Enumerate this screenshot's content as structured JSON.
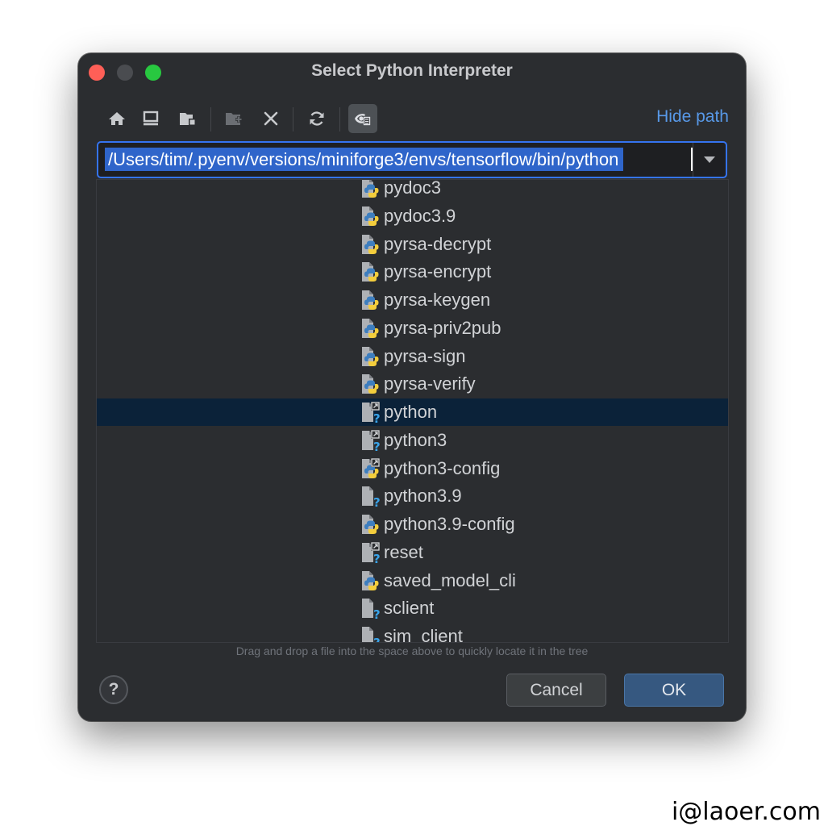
{
  "window": {
    "title": "Select Python Interpreter"
  },
  "toolbar": {
    "buttons": [
      {
        "icon": "home-icon"
      },
      {
        "icon": "desktop-icon"
      },
      {
        "icon": "project-folder-icon"
      },
      {
        "icon": "new-folder-icon"
      },
      {
        "icon": "delete-icon"
      },
      {
        "icon": "refresh-icon"
      },
      {
        "icon": "show-hidden-files-icon"
      }
    ],
    "hide_path_label": "Hide path"
  },
  "path_field": {
    "value": "/Users/tim/.pyenv/versions/miniforge3/envs/tensorflow/bin/python"
  },
  "tree": {
    "items": [
      {
        "label": "pydoc3",
        "icon": "python-file-icon"
      },
      {
        "label": "pydoc3.9",
        "icon": "python-file-icon"
      },
      {
        "label": "pyrsa-decrypt",
        "icon": "python-file-icon"
      },
      {
        "label": "pyrsa-encrypt",
        "icon": "python-file-icon"
      },
      {
        "label": "pyrsa-keygen",
        "icon": "python-file-icon"
      },
      {
        "label": "pyrsa-priv2pub",
        "icon": "python-file-icon"
      },
      {
        "label": "pyrsa-sign",
        "icon": "python-file-icon"
      },
      {
        "label": "pyrsa-verify",
        "icon": "python-file-icon"
      },
      {
        "label": "python",
        "icon": "unknown-link-file-icon",
        "selected": true
      },
      {
        "label": "python3",
        "icon": "unknown-link-file-icon"
      },
      {
        "label": "python3-config",
        "icon": "python-link-file-icon"
      },
      {
        "label": "python3.9",
        "icon": "unknown-file-icon"
      },
      {
        "label": "python3.9-config",
        "icon": "python-file-icon"
      },
      {
        "label": "reset",
        "icon": "unknown-link-file-icon"
      },
      {
        "label": "saved_model_cli",
        "icon": "python-file-icon"
      },
      {
        "label": "sclient",
        "icon": "unknown-file-icon"
      },
      {
        "label": "sim_client",
        "icon": "unknown-file-icon"
      }
    ]
  },
  "hint": "Drag and drop a file into the space above to quickly locate it in the tree",
  "buttons": {
    "help": "?",
    "cancel": "Cancel",
    "ok": "OK"
  },
  "watermark": "i@laoer.com",
  "colors": {
    "dialog_bg": "#2b2d30",
    "accent": "#3574f0",
    "link": "#5899e8",
    "selection": "#0b2239",
    "ok_button": "#365880"
  }
}
